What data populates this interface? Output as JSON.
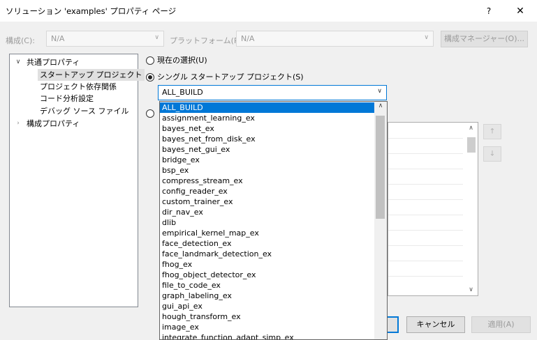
{
  "window": {
    "title": "ソリューション 'examples' プロパティ ページ",
    "help": "?",
    "close": "✕"
  },
  "toolbar": {
    "config_label": "構成(C):",
    "config_value": "N/A",
    "platform_label": "プラットフォーム(P):",
    "platform_value": "N/A",
    "manager_button": "構成マネージャー(O)..."
  },
  "tree": {
    "common": "共通プロパティ",
    "startup": "スタートアップ プロジェクト",
    "deps": "プロジェクト依存関係",
    "code_analysis": "コード分析設定",
    "debug_source": "デバッグ ソース ファイル",
    "config_props": "構成プロパティ"
  },
  "options": {
    "current_selection": "現在の選択(U)",
    "single_startup": "シングル スタートアップ プロジェクト(S)",
    "selected_project": "ALL_BUILD"
  },
  "dropdown": {
    "items": [
      "ALL_BUILD",
      "assignment_learning_ex",
      "bayes_net_ex",
      "bayes_net_from_disk_ex",
      "bayes_net_gui_ex",
      "bridge_ex",
      "bsp_ex",
      "compress_stream_ex",
      "config_reader_ex",
      "custom_trainer_ex",
      "dir_nav_ex",
      "dlib",
      "empirical_kernel_map_ex",
      "face_detection_ex",
      "face_landmark_detection_ex",
      "fhog_ex",
      "fhog_object_detector_ex",
      "file_to_code_ex",
      "graph_labeling_ex",
      "gui_api_ex",
      "hough_transform_ex",
      "image_ex",
      "integrate_function_adapt_simp_ex"
    ]
  },
  "buttons": {
    "cancel": "キャンセル",
    "apply": "適用(A)"
  },
  "icons": {
    "expanded": "chevron-down-icon",
    "collapsed": "chevron-right-icon",
    "move_up": "arrow-up-icon",
    "move_down": "arrow-down-icon"
  },
  "colors": {
    "accent": "#0078d7"
  }
}
